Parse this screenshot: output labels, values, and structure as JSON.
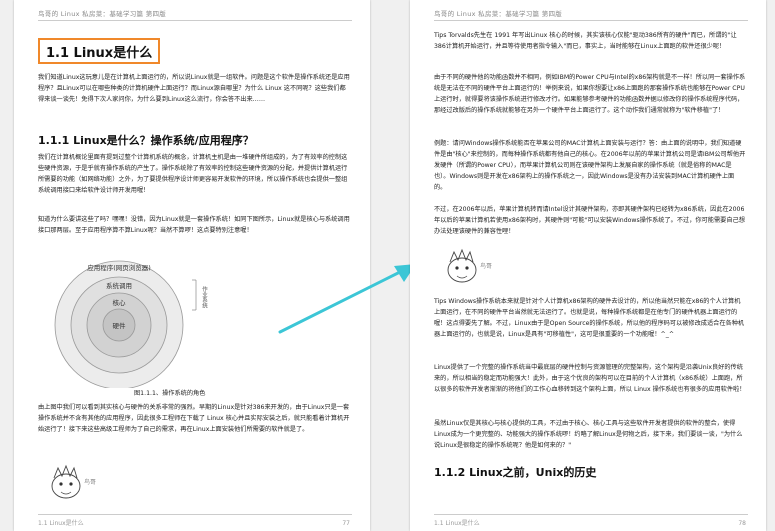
{
  "left_page": {
    "header": "鸟哥的 Linux 私房菜：基础学习篇 第四版",
    "title": "1.1 Linux是什么",
    "para1": "我们知道Linux这玩意儿是在计算机上面运行的，所以说Linux就是一组软件。问题是这个软件是操作系统还是应用程序？且Linux可以在哪些种类的计算机硬件上面运行？而Linux源自哪里？为什么 Linux 这不同呢？这些我们都得来谈一谈先！免得下次人家问你，为什么要到Linux这么流行，你会答不出来……",
    "section": "1.1.1 Linux是什么？操作系统/应用程序？",
    "para2": "我们在计算机概论里面有提到过整个计算机系统的概念，计算机主机是由一堆硬件所组成的，为了有效率的控制这些硬件资源，于是乎就有操作系统的产生了。操作系统除了有效率的控制这些硬件资源的分配，并提供计算机运行所需要的功能（如网络功能）之外，为了要提供程序设计师更容易开发软件的环境，所以操作系统也会提供一整组系统调用接口来给软件设计师开发用喔！",
    "para3": "知道为什么要讲这些了吗？嘿嘿！没错，因为Linux就是一套操作系统！如同下图所示，Linux就是核心与系统调用接口那两层。至于应用程序算不算Linux呢？当然不算啰！这点要特别注意喔！",
    "diagram": {
      "labels": [
        "应用程序(网页浏览器)",
        "系统调用",
        "核心",
        "硬件"
      ],
      "side_label": "作业系统"
    },
    "figure_caption": "图1.1.1、操作系统的角色",
    "para4": "由上图中我们可以看到其实核心与硬件的关系非常的强烈。早期的Linux是针对386来开发的，由于Linux只是一套操作系统并不含有其他的应用程序，因此很多工程师在下载了 Linux 核心并且实际安装之后，就只能看着计算机开始运行了！接下来这些高级工程师为了自己的需求，再在Linux上面安装他们所需要的软件就是了。",
    "footer_left": "1.1 Linux是什么",
    "footer_page": "77"
  },
  "right_page": {
    "header": "鸟哥的 Linux 私房菜：基础学习篇 第四版",
    "para1": "Tips Torvalds先生在 1991 年写出Linux 核心的时候，其实该核心仅能\"驱动386所有的硬件\"而已，所谓的\"让386计算机开始运行，并且等待使用者指令输入\"而已，事实上，当时能够在Linux上面跑的软件还很少呢！",
    "para2": "由于不同的硬件他的功能函数并不相同，例如IBM的Power CPU与Intel的x86架构就是不一样！所以同一套操作系统是无法在不同的硬件平台上面运行的！举例来说，如果你想要让x86上面跑的那套操作系统也能够在Power CPU上运行时，就得要将该操作系统进行修改才行。如果能够参考硬件的功能函数并据以修改你的操作系统程序代码，那经过改版后的操作系统就能够在另外一个硬件平台上面运行了。这个动作我们通常就称为\"软件移植\"了！",
    "para3": "例题：请问Windows操作系统能否在苹果公司的MAC计算机上面安装与运行？答：由上面的说明中，我们知道硬件是由\"核心\"来控制的，而每种操作系统都有他自己的核心。在2006年以前的苹果计算机公司是请IBM公司帮他开发硬件（所谓的Power CPU），而苹果计算机公司则在该硬件架构上发展自家的操作系统（就是俗称的MAC是也）。Windows则是开发在x86架构上的操作系统之一，因此Windows是没有办法安装到MAC计算机硬件上面的。",
    "para4": "不过，在2006年以后，苹果计算机转而请Intel设计其硬件架构，亦即其硬件架构已经转为x86系统，因此在2006年以后的苹果计算机若使用x86架构时，其硬件则\"可能\"可以安装Windows操作系统了。不过，你可能需要自己想办法处理该硬件的兼容性哩！",
    "para5": "Tips Windows操作系统本来就是针对个人计算机x86架构的硬件去设计的，所以他当然只能在x86的个人计算机上面运行，在不同的硬件平台当然就无法运行了。也就是说，每种操作系统都是在他专门的硬件机器上面运行的喔！这点得要先了解。不过，Linux由于是Open Source的操作系统，所以他的程序码可以被修改成适合在各种机器上面运行的，也就是说，Linux是具有\"可移植性\"，这可是很重要的一个功能喔！^_^",
    "para6": "Linux提供了一个完整的操作系统当中最底层的硬件控制与资源管理的完整架构，这个架构是沿袭Unix良好的传统来的，所以相当的稳定而功能强大！此外，由于这个优良的架构可以在目前的个人计算机（x86系统）上面跑，所以很多的软件开发者渐渐的将他们的工作心血移转到这个架构上面，所以 Linux 操作系统也有很多的应用软件啦！",
    "para7": "虽然Linux仅是其核心与核心提供的工具，不过由于核心、核心工具与这些软件开发者提供的软件的整合，使得Linux成为一个更完整的、功能强大的操作系统啰！约略了解Linux是何物之后，接下来，我们要谈一谈，\"为什么说Linux是很稳定的操作系统呢？他是如何来的？\"",
    "section": "1.1.2 Linux之前，Unix的历史",
    "footer_left": "1.1 Linux是什么",
    "footer_page": "78"
  },
  "colors": {
    "highlight_box": "#f0882a",
    "arrow": "#3cc6d6",
    "link": "#2a5db0"
  }
}
